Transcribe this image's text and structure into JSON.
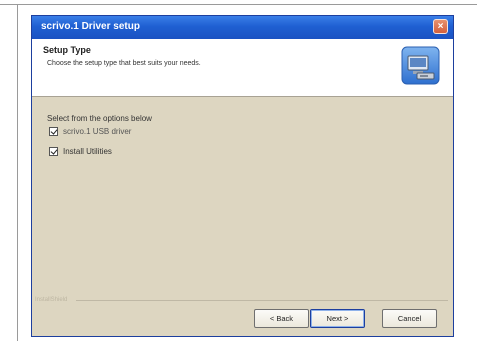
{
  "window": {
    "title": "scrivo.1 Driver setup",
    "close_glyph": "×"
  },
  "header": {
    "title": "Setup Type",
    "subtitle": "Choose the setup type that best suits your needs."
  },
  "options": {
    "group_label": "Select from the options below",
    "items": [
      {
        "label": "scrivo.1 USB driver",
        "checked": true
      },
      {
        "label": "Install Utilities",
        "checked": true
      }
    ]
  },
  "footer": {
    "brand": "InstallShield"
  },
  "buttons": {
    "back": "< Back",
    "next": "Next >",
    "cancel": "Cancel"
  },
  "colors": {
    "titlebar": "#1f5fd2",
    "dialog_bg": "#ddd6c1",
    "close": "#d35f3c"
  }
}
